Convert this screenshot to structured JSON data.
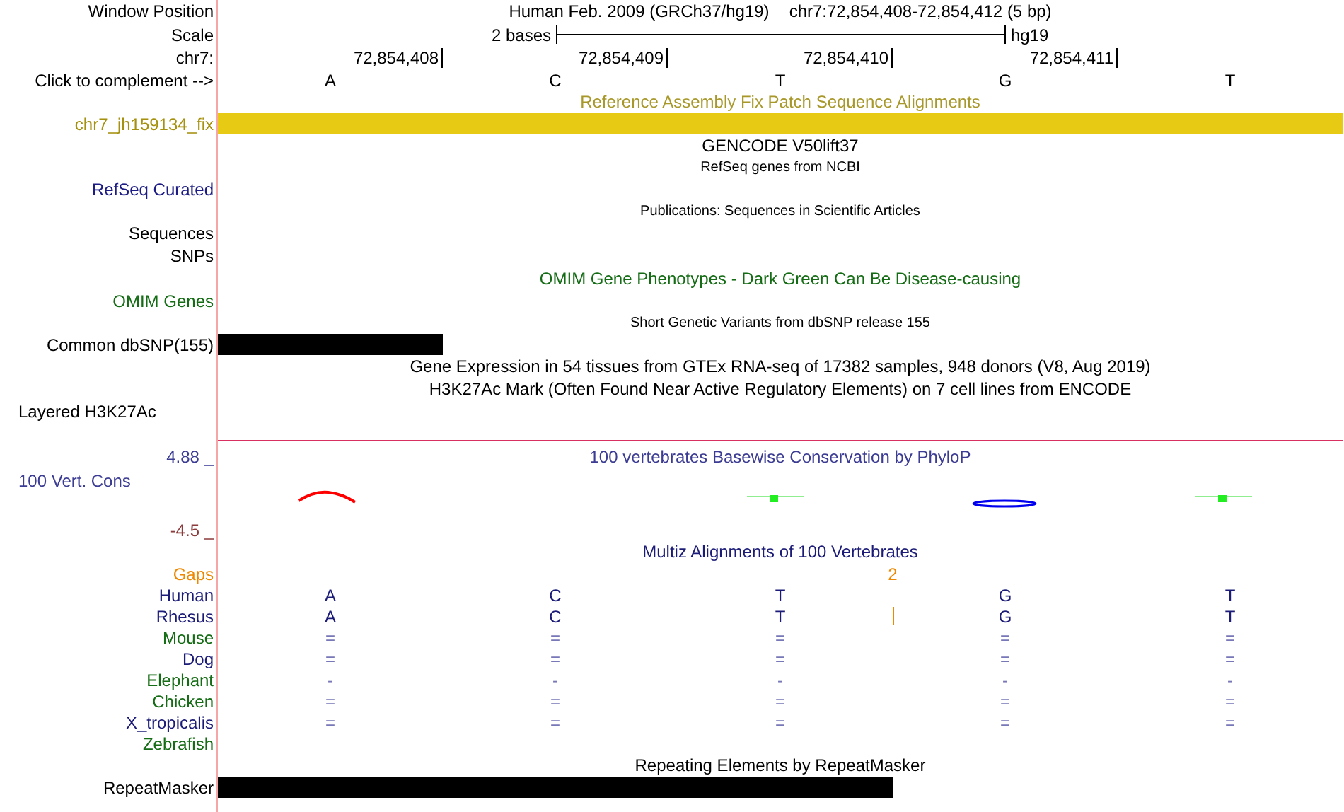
{
  "header": {
    "label": "Window Position",
    "assembly": "Human Feb. 2009 (GRCh37/hg19)",
    "position": "chr7:72,854,408-72,854,412 (5 bp)"
  },
  "scale": {
    "label": "Scale",
    "length": "2 bases",
    "database": "hg19"
  },
  "ruler": {
    "label": "chr7:",
    "ticks": [
      "72,854,408",
      "72,854,409",
      "72,854,410",
      "72,854,411"
    ]
  },
  "complement": {
    "label": "Click to complement -->",
    "bases": [
      "A",
      "C",
      "T",
      "G",
      "T"
    ]
  },
  "tracks": [
    {
      "kind": "title",
      "text": "Reference Assembly Fix Patch Sequence Alignments",
      "color": "#a8982a"
    },
    {
      "kind": "bar",
      "label": "chr7_jh159134_fix",
      "color": "#e6ca14",
      "level": 1
    },
    {
      "kind": "title",
      "text": "GENCODE V50lift37",
      "color": "#000000"
    },
    {
      "kind": "subtitle",
      "text": "RefSeq genes from NCBI",
      "color": "#000000"
    },
    {
      "kind": "label",
      "label": "RefSeq Curated",
      "color": "#1c1c84"
    },
    {
      "kind": "subtitle",
      "text": "Publications: Sequences in Scientific Articles",
      "color": "#000000"
    },
    {
      "kind": "label",
      "label": "Sequences",
      "color": "#000000"
    },
    {
      "kind": "label",
      "label": "SNPs",
      "color": "#000000"
    },
    {
      "kind": "title",
      "text": "OMIM Gene Phenotypes - Dark Green Can Be Disease-causing",
      "color": "#146c14"
    },
    {
      "kind": "label",
      "label": "OMIM Genes",
      "color": "#146c14"
    },
    {
      "kind": "subtitle",
      "text": "Short Genetic Variants from dbSNP release 155",
      "color": "#000000"
    },
    {
      "kind": "bar",
      "label": "Common dbSNP(155)",
      "color": "#000000",
      "level": 0.2
    },
    {
      "kind": "title",
      "text": "Gene Expression in 54 tissues from GTEx RNA-seq of 17382 samples, 948 donors (V8, Aug 2019)",
      "color": "#000000"
    },
    {
      "kind": "title",
      "text": "H3K27Ac Mark (Often Found Near Active Regulatory Elements) on 7 cell lines from ENCODE",
      "color": "#000000"
    },
    {
      "kind": "layered",
      "label": "Layered H3K27Ac",
      "color": "#000000"
    },
    {
      "kind": "conservation",
      "title": "100 vertebrates Basewise Conservation by PhyloP",
      "label": "100 Vert. Cons",
      "max": "4.88 _",
      "min": "-4.5 _",
      "color": "#3c3c94"
    },
    {
      "kind": "multiz",
      "title": "Multiz Alignments of 100 Vertebrates",
      "color": "#1c1c78",
      "gaps": {
        "label": "Gaps",
        "count": "2"
      },
      "species": [
        {
          "name": "Human",
          "color": "#1c1c78",
          "insertion": false,
          "bases": [
            "A",
            "C",
            "T",
            "G",
            "T"
          ]
        },
        {
          "name": "Rhesus",
          "color": "#1c1c78",
          "insertion": true,
          "bases": [
            "A",
            "C",
            "T",
            "G",
            "T"
          ]
        },
        {
          "name": "Mouse",
          "color": "#146c14",
          "insertion": false,
          "bases": [
            "=",
            "=",
            "=",
            "=",
            "="
          ]
        },
        {
          "name": "Dog",
          "color": "#1c1c78",
          "insertion": false,
          "bases": [
            "=",
            "=",
            "=",
            "=",
            "="
          ]
        },
        {
          "name": "Elephant",
          "color": "#146c14",
          "insertion": false,
          "bases": [
            "-",
            "-",
            "-",
            "-",
            "-"
          ]
        },
        {
          "name": "Chicken",
          "color": "#146c14",
          "insertion": false,
          "bases": [
            "=",
            "=",
            "=",
            "=",
            "="
          ]
        },
        {
          "name": "X_tropicalis",
          "color": "#1c1c78",
          "insertion": false,
          "bases": [
            "=",
            "=",
            "=",
            "=",
            "="
          ]
        },
        {
          "name": "Zebrafish",
          "color": "#146c14",
          "insertion": false
        }
      ]
    },
    {
      "kind": "title",
      "text": "Repeating Elements by RepeatMasker",
      "color": "#000000"
    },
    {
      "kind": "bar",
      "label": "RepeatMasker",
      "color": "#000000",
      "level": 0.6
    }
  ]
}
